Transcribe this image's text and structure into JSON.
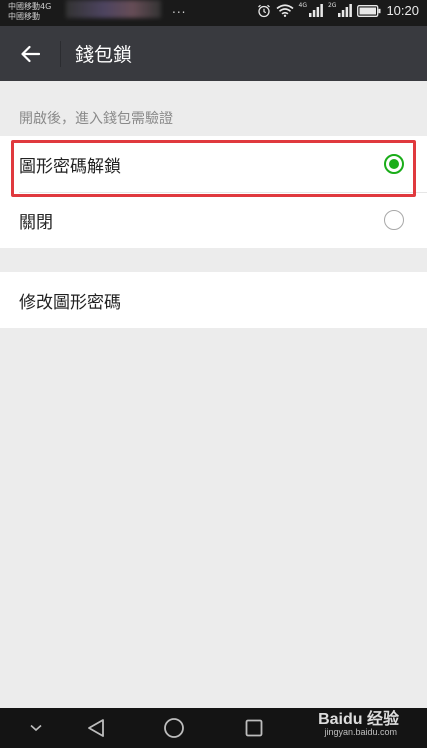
{
  "status_bar": {
    "carrier_1": "中國移動4G",
    "carrier_2": "中國移動",
    "more_dots": "...",
    "network_1": "4G",
    "network_2": "2G",
    "time": "10:20"
  },
  "app_bar": {
    "title": "錢包鎖"
  },
  "section": {
    "hint": "開啟後，進入錢包需驗證"
  },
  "options": [
    {
      "label": "圖形密碼解鎖",
      "selected": true
    },
    {
      "label": "關閉",
      "selected": false
    }
  ],
  "actions": {
    "modify_label": "修改圖形密碼"
  },
  "watermark": {
    "brand": "Baidu 经验",
    "url": "jingyan.baidu.com"
  },
  "colors": {
    "accent": "#1aad19",
    "highlight": "#e0393e",
    "app_bar": "#393a3f"
  }
}
